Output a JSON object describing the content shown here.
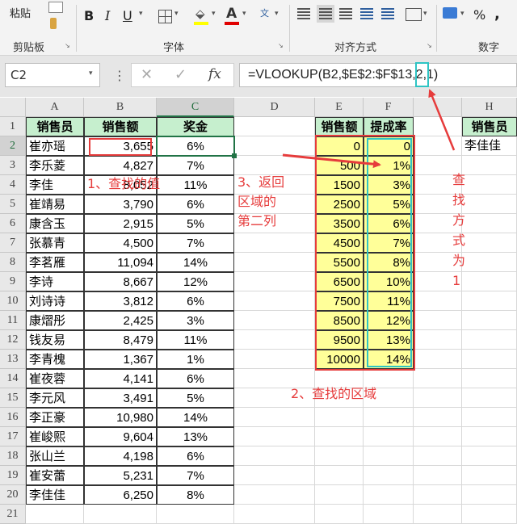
{
  "ribbon": {
    "paste_label": "粘贴",
    "bold": "B",
    "italic": "I",
    "underline": "U",
    "font_color_glyph": "A",
    "percent": "%",
    "comma": ",",
    "groups": [
      "剪贴板",
      "字体",
      "对齐方式",
      "数字"
    ]
  },
  "formula_bar": {
    "name_box": "C2",
    "fx": "fx",
    "formula": "=VLOOKUP(B2,$E$2:$F$13,2,1)"
  },
  "columns": [
    "A",
    "B",
    "C",
    "D",
    "E",
    "F",
    "",
    "H"
  ],
  "rows": [
    "1",
    "2",
    "3",
    "4",
    "5",
    "6",
    "7",
    "8",
    "9",
    "10",
    "11",
    "12",
    "13",
    "14",
    "15",
    "16",
    "17",
    "18",
    "19",
    "20",
    "21"
  ],
  "sales_table": {
    "headers": [
      "销售员",
      "销售额",
      "奖金"
    ],
    "records": [
      [
        "崔亦瑶",
        "3,655",
        "6%"
      ],
      [
        "李乐菱",
        "4,827",
        "7%"
      ],
      [
        "李佳",
        "8,052",
        "11%"
      ],
      [
        "崔靖易",
        "3,790",
        "6%"
      ],
      [
        "康含玉",
        "2,915",
        "5%"
      ],
      [
        "张慕青",
        "4,500",
        "7%"
      ],
      [
        "李茗雁",
        "11,094",
        "14%"
      ],
      [
        "李诗",
        "8,667",
        "12%"
      ],
      [
        "刘诗诗",
        "3,812",
        "6%"
      ],
      [
        "康熠彤",
        "2,425",
        "3%"
      ],
      [
        "钱友易",
        "8,479",
        "11%"
      ],
      [
        "李青槐",
        "1,367",
        "1%"
      ],
      [
        "崔夜蓉",
        "4,141",
        "6%"
      ],
      [
        "李元风",
        "3,491",
        "5%"
      ],
      [
        "李正豪",
        "10,980",
        "14%"
      ],
      [
        "崔峻熙",
        "9,604",
        "13%"
      ],
      [
        "张山兰",
        "4,198",
        "6%"
      ],
      [
        "崔安蕾",
        "5,231",
        "7%"
      ],
      [
        "李佳佳",
        "6,250",
        "8%"
      ]
    ]
  },
  "rate_table": {
    "headers": [
      "销售额",
      "提成率"
    ],
    "records": [
      [
        "0",
        "0"
      ],
      [
        "500",
        "1%"
      ],
      [
        "1500",
        "3%"
      ],
      [
        "2500",
        "5%"
      ],
      [
        "3500",
        "6%"
      ],
      [
        "4500",
        "7%"
      ],
      [
        "5500",
        "8%"
      ],
      [
        "6500",
        "10%"
      ],
      [
        "7500",
        "11%"
      ],
      [
        "8500",
        "12%"
      ],
      [
        "9500",
        "13%"
      ],
      [
        "10000",
        "14%"
      ]
    ]
  },
  "lookup": {
    "header": "销售员",
    "value": "李佳佳"
  },
  "annotations": {
    "lookup_value": "1、查找的值",
    "return_column": [
      "3、返回",
      "区域的",
      "第二列"
    ],
    "lookup_range": "2、查找的区域",
    "match_mode": [
      "查",
      "找",
      "方",
      "式",
      "为",
      "1"
    ]
  },
  "colors": {
    "header_fill": "#c6efce",
    "rate_fill": "#ffff99",
    "annotation": "#e63c3c",
    "highlight_teal": "#2ec4c4",
    "excel_green": "#217346"
  }
}
